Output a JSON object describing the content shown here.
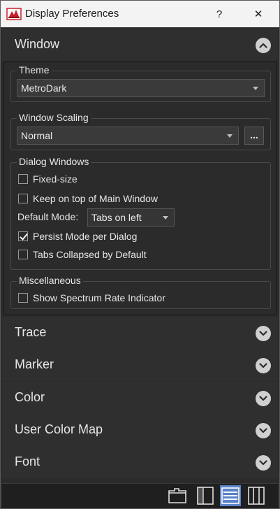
{
  "window": {
    "title": "Display Preferences",
    "help_label": "?",
    "close_label": "✕"
  },
  "sections": {
    "window": {
      "label": "Window",
      "expanded": true,
      "theme": {
        "legend": "Theme",
        "value": "MetroDark"
      },
      "scaling": {
        "legend": "Window Scaling",
        "value": "Normal",
        "more_label": "..."
      },
      "dialogs": {
        "legend": "Dialog Windows",
        "fixed_size": {
          "label": "Fixed-size",
          "checked": false
        },
        "keep_on_top": {
          "label": "Keep on top of Main Window",
          "checked": false
        },
        "default_mode_label": "Default Mode:",
        "default_mode_value": "Tabs on left",
        "persist_mode": {
          "label": "Persist Mode per Dialog",
          "checked": true
        },
        "tabs_collapsed": {
          "label": "Tabs Collapsed by Default",
          "checked": false
        }
      },
      "misc": {
        "legend": "Miscellaneous",
        "show_rate": {
          "label": "Show Spectrum Rate Indicator",
          "checked": false
        }
      }
    },
    "trace": {
      "label": "Trace"
    },
    "marker": {
      "label": "Marker"
    },
    "color": {
      "label": "Color"
    },
    "user_color_map": {
      "label": "User Color Map"
    },
    "font": {
      "label": "Font"
    }
  },
  "toolbar": {
    "buttons": [
      "tabbed-layout-icon",
      "side-panel-layout-icon",
      "stacked-layout-icon",
      "columns-layout-icon"
    ],
    "active_button": "stacked-layout-icon"
  },
  "colors": {
    "background": "#2b2b2b",
    "accent": "#5a84c8",
    "titlebar": "#f3f3f3"
  }
}
